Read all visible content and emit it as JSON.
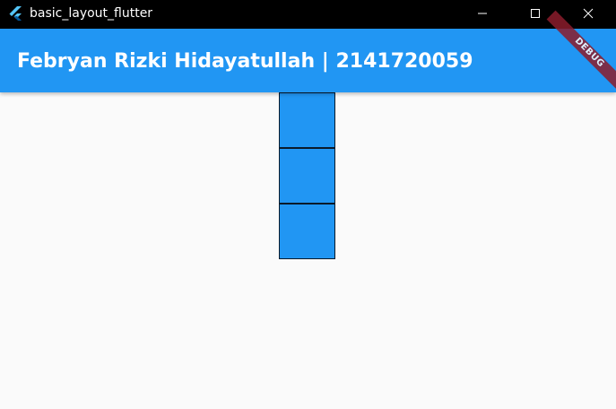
{
  "window": {
    "title": "basic_layout_flutter",
    "icon": "flutter-logo-icon"
  },
  "window_controls": {
    "minimize_icon": "minimize-icon",
    "maximize_icon": "maximize-icon",
    "close_icon": "close-icon"
  },
  "appbar": {
    "title": "Febryan Rizki Hidayatullah | 2141720059",
    "color": "#2196f3"
  },
  "debug_banner": {
    "label": "DEBUG"
  },
  "boxes": {
    "count": 3,
    "color": "#2196f3"
  }
}
